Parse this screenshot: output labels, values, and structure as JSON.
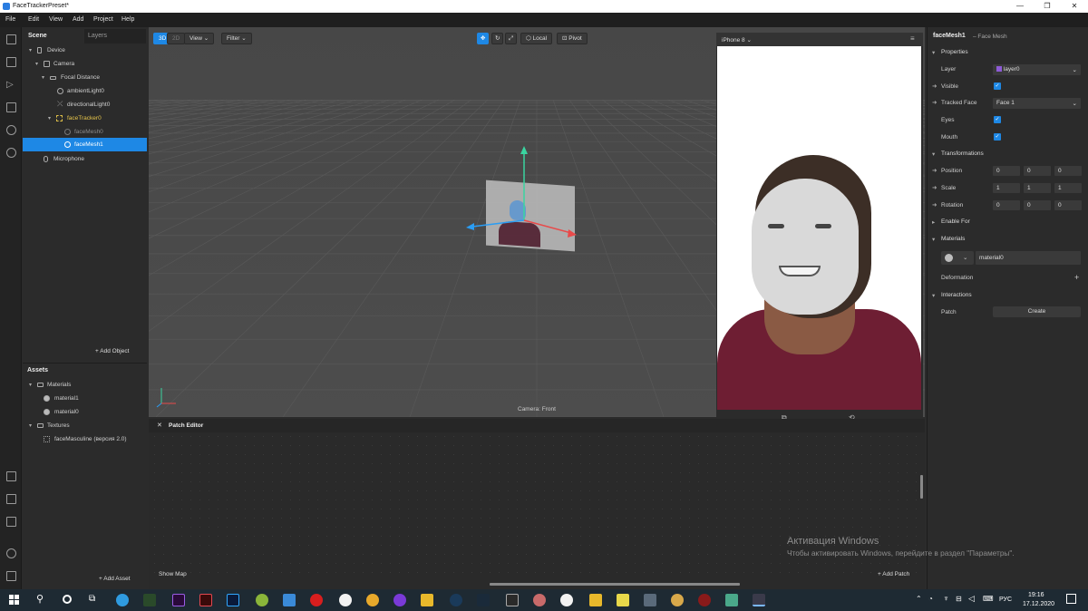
{
  "window": {
    "title": "FaceTrackerPreset*"
  },
  "menu": [
    "File",
    "Edit",
    "View",
    "Add",
    "Project",
    "Help"
  ],
  "scene": {
    "tabs": [
      "Scene",
      "Layers"
    ],
    "tree": [
      "Device",
      "Camera",
      "Focal Distance",
      "ambientLight0",
      "directionalLight0",
      "faceTracker0",
      "faceMesh0",
      "faceMesh1",
      "Microphone"
    ],
    "add_object": "Add Object"
  },
  "assets": {
    "title": "Assets",
    "items": [
      "Materials",
      "material1",
      "material0",
      "Textures",
      "faceMasculine (версия 2.0)"
    ],
    "add_asset": "Add Asset"
  },
  "viewport": {
    "mode_3d": "3D",
    "mode_2d": "2D",
    "view": "View",
    "filter": "Filter",
    "local": "Local",
    "pivot": "Pivot",
    "camera_label": "Camera: Front"
  },
  "preview": {
    "device": "iPhone 8"
  },
  "inspector": {
    "object_name": "faceMesh1",
    "object_type": "– Face Mesh",
    "properties_header": "Properties",
    "layer_label": "Layer",
    "layer_value": "layer0",
    "visible_label": "Visible",
    "tracked_face_label": "Tracked Face",
    "tracked_face_value": "Face 1",
    "eyes_label": "Eyes",
    "mouth_label": "Mouth",
    "transformations_header": "Transformations",
    "position_label": "Position",
    "scale_label": "Scale",
    "rotation_label": "Rotation",
    "position": [
      "0",
      "0",
      "0"
    ],
    "scale": [
      "1",
      "1",
      "1"
    ],
    "rotation": [
      "0",
      "0",
      "0"
    ],
    "enable_for": "Enable For",
    "materials_header": "Materials",
    "material_value": "material0",
    "deformation": "Deformation",
    "interactions_header": "Interactions",
    "patch_label": "Patch",
    "create_button": "Create"
  },
  "patch_editor": {
    "title": "Patch Editor",
    "show_map": "Show Map",
    "add_patch": "Add Patch"
  },
  "watermark": {
    "line1": "Активация Windows",
    "line2": "Чтобы активировать Windows, перейдите в раздел \"Параметры\"."
  },
  "taskbar": {
    "lang": "РУС",
    "time": "19:16",
    "date": "17.12.2020"
  }
}
